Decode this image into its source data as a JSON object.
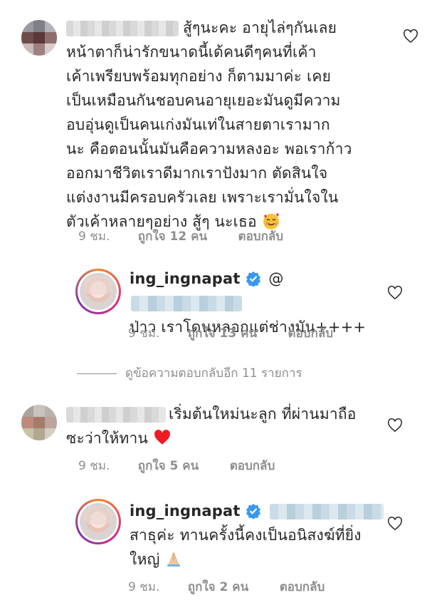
{
  "comments": [
    {
      "username": "",
      "lines": [
        "สู้ๆนะคะ อายุไล่ๆกันเลย",
        "หน้าตาก็น่ารักขนาดนี้เด้คนดีๆคนที่เค้า",
        "เค้าเพรียบพร้อมทุกอย่าง ก็ตามมาค่ะ เคย",
        "เป็นเหมือนกันชอบคนอายุเยอะมันดูมีความ",
        "อบอุ่นดูเป็นคนเก่งมันเท่ในสายตาเรามาก",
        "นะ คือตอนนั้นมันคือความหลงอะ พอเราก้าว",
        "ออกมาชีวิตเราดีมากเราปังมาก ตัดสินใจ",
        "แต่งงานมีครอบครัวเลย เพราะเรามั่นใจใน",
        "ตัวเค้าหลายๆอย่าง สู้ๆ นะเธอ"
      ],
      "time": "9 ชม.",
      "likes": "ถูกใจ 12 คน",
      "reply": "ตอบกลับ"
    },
    {
      "username": "ing_ingnapat",
      "mention": "@",
      "lines": [
        "ป่าว เราโดนหลอกแต่ช่างมัน++++"
      ],
      "time": "9 ชม.",
      "likes": "ถูกใจ 13 คน",
      "reply": "ตอบกลับ"
    },
    {
      "username": "",
      "lines": [
        "เริ่มต้นใหม่นะลูก ที่ผ่านมาถือ",
        "ซะว่าให้ทาน"
      ],
      "time": "9 ชม.",
      "likes": "ถูกใจ 5 คน",
      "reply": "ตอบกลับ"
    },
    {
      "username": "ing_ingnapat",
      "lines": [
        "สาธุค่ะ ทานครั้งนี้คงเป็นอนิสงฆ์ที่ยิ่ง",
        "ใหญ่"
      ],
      "time": "9 ชม.",
      "likes": "ถูกใจ 2 คน",
      "reply": "ตอบกลับ"
    }
  ],
  "view_replies": "ดูข้อความตอบกลับอีก 11 รายการ",
  "colors": {
    "text": "#262626",
    "muted": "#8e8e8e",
    "verified": "#3897f0",
    "heart": "#ed1c24"
  },
  "icons": [
    "heart-outline-icon",
    "verified-badge-icon",
    "smiling-face-with-hearts-emoji",
    "red-heart-emoji",
    "folded-hands-emoji"
  ]
}
